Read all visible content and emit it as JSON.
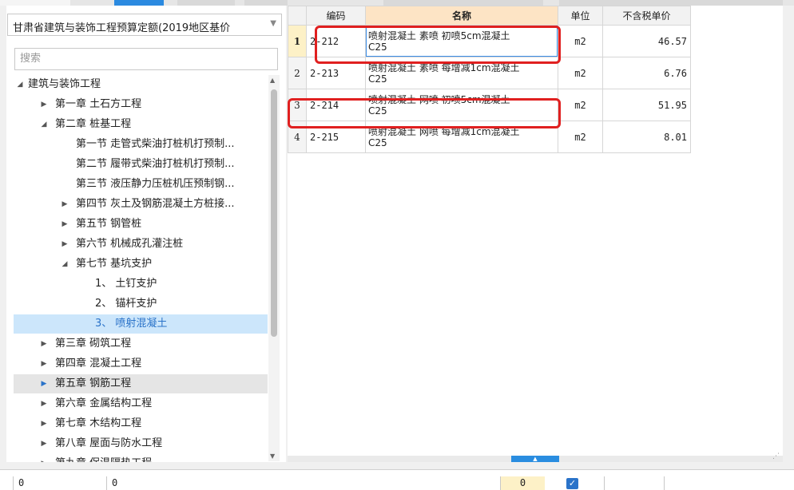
{
  "library": {
    "selected": "甘肃省建筑与装饰工程预算定额(2019地区基价"
  },
  "search": {
    "placeholder": "搜索"
  },
  "tree": [
    {
      "label": "建筑与装饰工程",
      "toggle": "◢"
    },
    {
      "label": "第一章 土石方工程",
      "toggle": "▶"
    },
    {
      "label": "第二章 桩基工程",
      "toggle": "◢"
    },
    {
      "label": "第一节 走管式柴油打桩机打预制...",
      "toggle": ""
    },
    {
      "label": "第二节 履带式柴油打桩机打预制...",
      "toggle": ""
    },
    {
      "label": "第三节 液压静力压桩机压预制钢...",
      "toggle": ""
    },
    {
      "label": "第四节 灰土及钢筋混凝土方桩接...",
      "toggle": "▶"
    },
    {
      "label": "第五节 钢管桩",
      "toggle": "▶"
    },
    {
      "label": "第六节 机械成孔灌注桩",
      "toggle": "▶"
    },
    {
      "label": "第七节 基坑支护",
      "toggle": "◢"
    },
    {
      "label": "1、 土钉支护",
      "toggle": ""
    },
    {
      "label": "2、 锚杆支护",
      "toggle": ""
    },
    {
      "label": "3、 喷射混凝土",
      "toggle": ""
    },
    {
      "label": "第三章 砌筑工程",
      "toggle": "▶"
    },
    {
      "label": "第四章 混凝土工程",
      "toggle": "▶"
    },
    {
      "label": "第五章 钢筋工程",
      "toggle": "▶"
    },
    {
      "label": "第六章 金属结构工程",
      "toggle": "▶"
    },
    {
      "label": "第七章 木结构工程",
      "toggle": "▶"
    },
    {
      "label": "第八章 屋面与防水工程",
      "toggle": "▶"
    },
    {
      "label": "第九章 保温隔热工程",
      "toggle": "▶"
    }
  ],
  "grid": {
    "headers": {
      "code": "编码",
      "name": "名称",
      "unit": "单位",
      "price": "不含税单价"
    },
    "rows": [
      {
        "n": "1",
        "code": "2-212",
        "name": "喷射混凝土 素喷 初喷5cm混凝土",
        "grade": "C25",
        "unit": "m2",
        "price": "46.57"
      },
      {
        "n": "2",
        "code": "2-213",
        "name": "喷射混凝土 素喷 每增减1cm混凝土",
        "grade": "C25",
        "unit": "m2",
        "price": "6.76"
      },
      {
        "n": "3",
        "code": "2-214",
        "name": "喷射混凝土 网喷 初喷5cm混凝土",
        "grade": "C25",
        "unit": "m2",
        "price": "51.95"
      },
      {
        "n": "4",
        "code": "2-215",
        "name": "喷射混凝土 网喷 每增减1cm混凝土",
        "grade": "C25",
        "unit": "m2",
        "price": "8.01"
      }
    ]
  },
  "bottom": {
    "cells": [
      "0",
      "0",
      "0"
    ],
    "checked": "✓"
  },
  "colors": {
    "highlight": "#e02020",
    "selected_bg": "#cce6fb",
    "header_accent": "#fde4c5",
    "accent": "#2a73c9"
  }
}
